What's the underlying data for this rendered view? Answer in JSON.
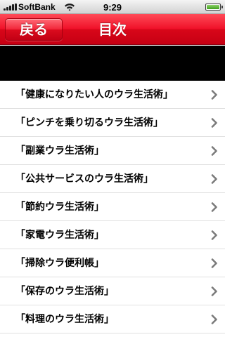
{
  "status_bar": {
    "carrier": "SoftBank",
    "time": "9:29",
    "signal_bars": 5,
    "wifi_icon": "wifi-icon",
    "battery_level": 1.0
  },
  "nav_bar": {
    "back_label": "戻る",
    "title": "目次",
    "color": "#e3101f"
  },
  "list": {
    "items": [
      {
        "label": "「健康になりたい人のウラ生活術」"
      },
      {
        "label": "「ピンチを乗り切るウラ生活術」"
      },
      {
        "label": "「副業ウラ生活術」"
      },
      {
        "label": "「公共サービスのウラ生活術」"
      },
      {
        "label": "「節約ウラ生活術」"
      },
      {
        "label": "「家電ウラ生活術」"
      },
      {
        "label": "「掃除ウラ便利帳」"
      },
      {
        "label": "「保存のウラ生活術」"
      },
      {
        "label": "「料理のウラ生活術」"
      }
    ],
    "accessory_icon": "chevron-right-icon"
  }
}
